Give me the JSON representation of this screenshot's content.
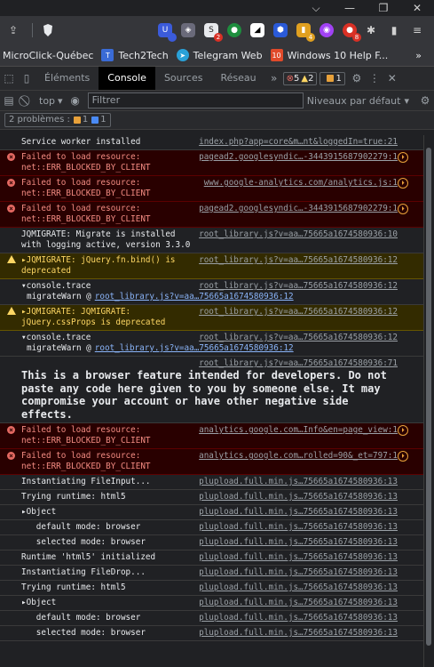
{
  "window": {
    "minimize": "⌵",
    "restore": "❐",
    "close": "✕"
  },
  "bookmarks": [
    {
      "label": "MicroClick-Québec",
      "color": "",
      "glyph": ""
    },
    {
      "label": "Tech2Tech",
      "color": "#3a6bd6",
      "glyph": "T"
    },
    {
      "label": "Telegram Web",
      "color": "#2aa1d8",
      "glyph": "➤"
    },
    {
      "label": "Windows 10 Help F...",
      "color": "#e04a2a",
      "glyph": "10"
    }
  ],
  "bookmarks_more": "»",
  "extensions": {
    "badges": [
      "",
      "",
      "2",
      "",
      "",
      "",
      "4",
      "",
      "8"
    ]
  },
  "devtools": {
    "tabs": [
      "Éléments",
      "Console",
      "Sources",
      "Réseau"
    ],
    "more": "»",
    "error_count": "5",
    "warn_count": "2",
    "info_count": "1",
    "context": "top",
    "filter_placeholder": "Filtrer",
    "levels": "Niveaux par défaut",
    "issues_label": "2 problèmes :",
    "issues_warn": "1",
    "issues_info": "1"
  },
  "console": [
    {
      "type": "log",
      "text": "Service worker installed",
      "source": "index.php?app=core&m…nt&loggedIn=true:21"
    },
    {
      "type": "error",
      "text": "Failed to load resource:\nnet::ERR_BLOCKED_BY_CLIENT",
      "source": "pagead2.googlesyndic…-3443915687902279:1"
    },
    {
      "type": "error",
      "text": "Failed to load resource:\nnet::ERR_BLOCKED_BY_CLIENT",
      "source": "www.google-analytics.com/analytics.js:1"
    },
    {
      "type": "error",
      "text": "Failed to load resource:\nnet::ERR_BLOCKED_BY_CLIENT",
      "source": "pagead2.googlesyndic…-3443915687902279:1"
    },
    {
      "type": "log",
      "text": "JQMIGRATE: Migrate is installed\nwith logging active, version 3.3.0",
      "source": "root_library.js?v=aa…75665a1674580936:10"
    },
    {
      "type": "warn",
      "text": "▸JQMIGRATE: jQuery.fn.bind() is\ndeprecated",
      "source": "root_library.js?v=aa…75665a1674580936:12"
    },
    {
      "type": "trace",
      "text": "▾console.trace",
      "source": "root_library.js?v=aa…75665a1674580936:12",
      "sub": "migrateWarn @",
      "sub_link": "root_library.js?v=aa…75665a1674580936:12"
    },
    {
      "type": "warn",
      "text": "▸JQMIGRATE: JQMIGRATE:\njQuery.cssProps is deprecated",
      "source": "root_library.js?v=aa…75665a1674580936:12"
    },
    {
      "type": "trace",
      "text": "▾console.trace",
      "source": "root_library.js?v=aa…75665a1674580936:12",
      "sub": "migrateWarn @",
      "sub_link": "root_library.js?v=aa…75665a1674580936:12"
    },
    {
      "type": "big",
      "text": "This is a browser feature intended for developers. Do not paste any code here given to you by someone else. It may compromise your account or have other negative side effects.",
      "source": "root_library.js?v=aa…75665a1674580936:71"
    },
    {
      "type": "error",
      "text": "Failed to load resource:\nnet::ERR_BLOCKED_BY_CLIENT",
      "source": "analytics.google.com…Info&en=page_view:1"
    },
    {
      "type": "error",
      "text": "Failed to load resource:\nnet::ERR_BLOCKED_BY_CLIENT",
      "source": "analytics.google.com…rolled=90&_et=797:1"
    },
    {
      "type": "log",
      "text": "Instantiating FileInput...",
      "source": "plupload.full.min.js…75665a1674580936:13"
    },
    {
      "type": "log",
      "text": "Trying runtime: html5",
      "source": "plupload.full.min.js…75665a1674580936:13"
    },
    {
      "type": "log",
      "text": "▸Object",
      "source": "plupload.full.min.js…75665a1674580936:13"
    },
    {
      "type": "log",
      "text": "   default mode: browser",
      "source": "plupload.full.min.js…75665a1674580936:13"
    },
    {
      "type": "log",
      "text": "   selected mode: browser",
      "source": "plupload.full.min.js…75665a1674580936:13"
    },
    {
      "type": "log",
      "text": "Runtime 'html5' initialized",
      "source": "plupload.full.min.js…75665a1674580936:13"
    },
    {
      "type": "log",
      "text": "Instantiating FileDrop...",
      "source": "plupload.full.min.js…75665a1674580936:13"
    },
    {
      "type": "log",
      "text": "Trying runtime: html5",
      "source": "plupload.full.min.js…75665a1674580936:13"
    },
    {
      "type": "log",
      "text": "▸Object",
      "source": "plupload.full.min.js…75665a1674580936:13"
    },
    {
      "type": "log",
      "text": "   default mode: browser",
      "source": "plupload.full.min.js…75665a1674580936:13"
    },
    {
      "type": "log",
      "text": "   selected mode: browser",
      "source": "plupload.full.min.js…75665a1674580936:13"
    }
  ]
}
